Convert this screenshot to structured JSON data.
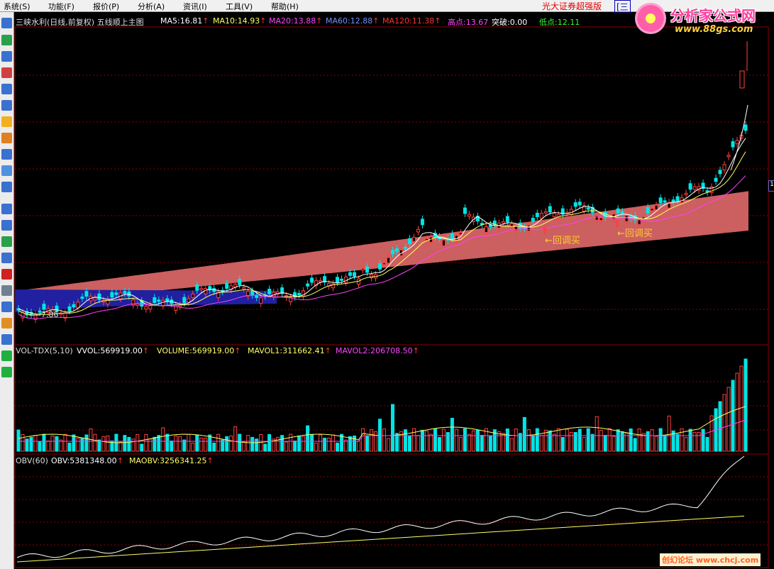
{
  "menu": {
    "items": [
      "系统(S)",
      "功能(F)",
      "报价(P)",
      "分析(A)",
      "资讯(I)",
      "工具(V)",
      "帮助(H)"
    ],
    "broker": "光大证券超强版",
    "broker_tag": "[三"
  },
  "logo": {
    "title": "分析家公式网",
    "url": "www.88gs.com"
  },
  "main_header": {
    "stock": "三峡水利(日线,前复权) 五线顺上主图",
    "ma5": "MA5:16.81",
    "ma10": "MA10:14.93",
    "ma20": "MA20:13.88",
    "ma60": "MA60:12.88",
    "ma120": "MA120:11.38",
    "high": "高点:13.67",
    "break": "突破:0.00",
    "low": "低点:12.11",
    "arrow": "↑"
  },
  "annotations": {
    "buy1": "←回调买",
    "buy2": "←回调买",
    "low_price": "7.86"
  },
  "vol_header": {
    "name": "VOL-TDX(5,10)",
    "vvol": "VVOL:569919.00",
    "volume": "VOLUME:569919.00",
    "mavol1": "MAVOL1:311662.41",
    "mavol2": "MAVOL2:206708.50",
    "arrow": "↑"
  },
  "obv_header": {
    "name": "OBV(60)",
    "obv": "OBV:5381348.00",
    "maobv": "MAOBV:3256341.25",
    "arrow": "↑"
  },
  "watermark": "创幻论坛 www.chcj.com",
  "colors": {
    "up": "#ff4040",
    "down": "#00e5e5",
    "ma5": "#ffffff",
    "ma10": "#ffff60",
    "ma20": "#ff40ff",
    "ma60": "#6080ff",
    "ma120": "#ff4040",
    "band_pink": "#f07070",
    "band_blue": "#2020a0",
    "grid": "#8b0000"
  },
  "icons": [
    "chart-icon",
    "line-icon",
    "candle-icon",
    "list-icon",
    "grid-icon",
    "news-icon",
    "folder-icon",
    "people-icon",
    "calc-icon",
    "search-icon",
    "etf-icon",
    "wave-icon",
    "rsi-icon",
    "screen-icon",
    "grid2-icon",
    "dollar-icon",
    "tool-icon",
    "move-icon",
    "pencil-icon",
    "zoomin-icon",
    "arrow-up-icon",
    "arrow-down-icon"
  ]
}
